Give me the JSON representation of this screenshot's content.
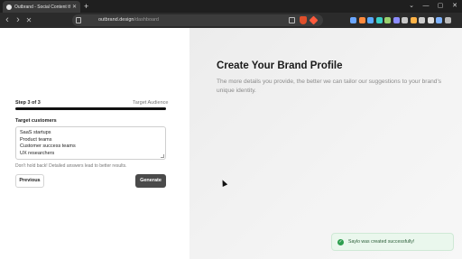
{
  "browser": {
    "tab_title": "Outbrand - Social Content that...",
    "tab_close": "✕",
    "new_tab": "+",
    "back": "‹",
    "forward": "›",
    "stop": "✕",
    "url_domain": "outbrand.design",
    "url_path": "/dashboard",
    "window_controls": [
      "⌄",
      "—",
      "▢",
      "✕"
    ],
    "extension_colors": [
      "#6aa6ff",
      "#ff8a3d",
      "#5aa9ff",
      "#3ad0c7",
      "#9ad06e",
      "#8c8cff",
      "#c8c8c8",
      "#ffb347",
      "#cccccc",
      "#dddddd",
      "#7fb3ff",
      "#bbbbbb"
    ]
  },
  "form": {
    "step": "Step 3 of 3",
    "step_label": "Target Audience",
    "progress_fraction": 1.0,
    "field_label": "Target customers",
    "field_lines": [
      "SaaS startups",
      "Product teams",
      "Customer success teams",
      "UX researchers"
    ],
    "hint": "Don't hold back! Detailed answers lead to better results.",
    "previous_label": "Previous",
    "generate_label": "Generate"
  },
  "hero": {
    "title": "Create Your Brand Profile",
    "subtitle": "The more details you provide, the better we can tailor our suggestions to your brand's unique identity."
  },
  "toast": {
    "icon": "✓",
    "message": "Saylo was created successfully!"
  },
  "colors": {
    "accent_dark": "#111111",
    "button_dark": "#4a4a4a",
    "toast_bg": "#eaf7ed",
    "toast_icon": "#2e9e4f"
  }
}
